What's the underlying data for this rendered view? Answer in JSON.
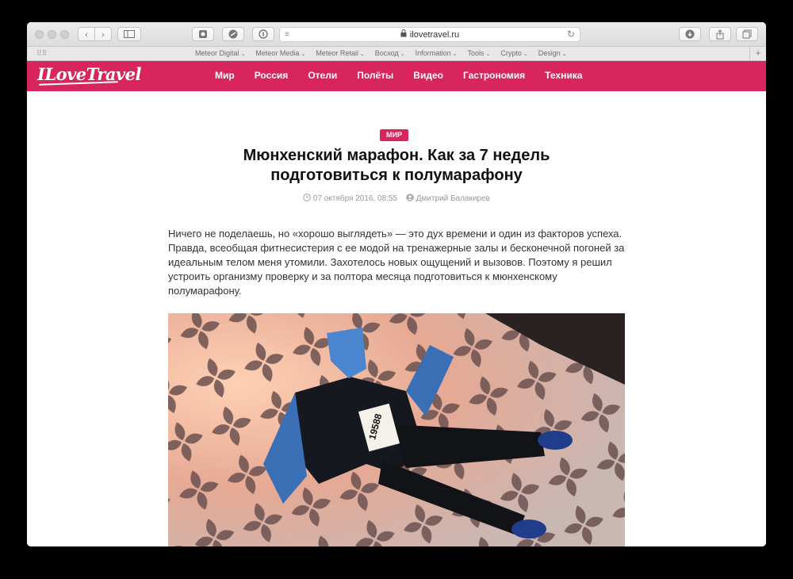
{
  "browser": {
    "url": "ilovetravel.ru",
    "bookmarks": [
      "Meteor Digital",
      "Meteor Media",
      "Meteor Retail",
      "Восход",
      "Information",
      "Tools",
      "Crypto",
      "Design"
    ]
  },
  "site": {
    "logo": "ILoveTravel",
    "nav": [
      "Мир",
      "Россия",
      "Отели",
      "Полёты",
      "Видео",
      "Гастрономия",
      "Техника"
    ],
    "brand_color": "#d9255e"
  },
  "article": {
    "category": "Мир",
    "title_line1": "Мюнхенский марафон. Как за 7 недель",
    "title_line2": "подготовиться к полумарафону",
    "date": "07 октября 2016, 08:55",
    "author": "Дмитрий Балакирев",
    "lead": "Ничего не поделаешь, но «хорошо выглядеть» — это дух времени и один из факторов успеха. Правда, всеобщая фитнесистерия с ее модой на тренажерные залы и бесконечной погоней за идеальным телом меня утомили. Захотелось новых ощущений и вызовов. Поэтому я решил устроить организму проверку и за полтора месяца подготовиться к мюнхенскому полумарафону.",
    "photo_bib": "19588"
  }
}
